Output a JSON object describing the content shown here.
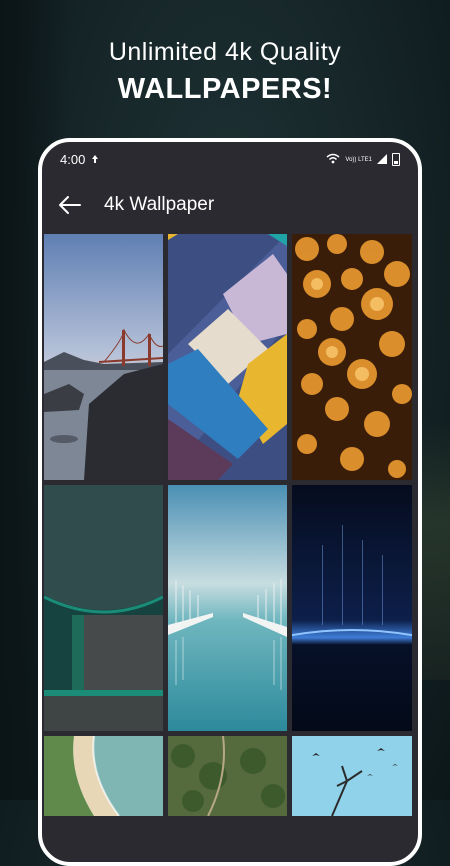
{
  "promo": {
    "line1": "Unlimited 4k Quality",
    "line2": "WALLPAPERS!"
  },
  "status_bar": {
    "time": "4:00",
    "network_label": "Vo)) LTE1"
  },
  "app_bar": {
    "title": "4k Wallpaper",
    "back_icon": "arrow-left-icon"
  },
  "wallpapers": [
    {
      "subject": "golden gate bridge seascape"
    },
    {
      "subject": "material geometric shapes"
    },
    {
      "subject": "orange bokeh rain drops"
    },
    {
      "subject": "dark teal material curves"
    },
    {
      "subject": "marina boats reflection"
    },
    {
      "subject": "blue planet horizon glow"
    },
    {
      "subject": "aerial beach shoreline"
    },
    {
      "subject": "aerial green forest"
    },
    {
      "subject": "blue sky birds tree"
    }
  ],
  "colors": {
    "page_background": "#152427",
    "phone_screen": "#2b2a30",
    "text": "#ffffff"
  }
}
